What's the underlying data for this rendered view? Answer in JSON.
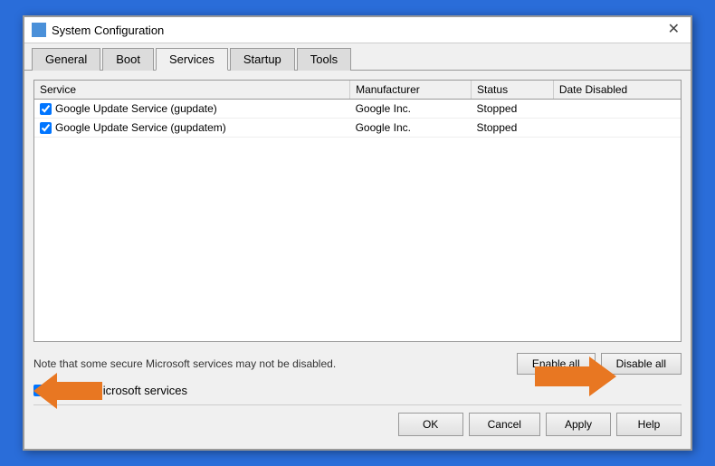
{
  "window": {
    "title": "System Configuration",
    "close_label": "✕"
  },
  "tabs": [
    {
      "id": "general",
      "label": "General"
    },
    {
      "id": "boot",
      "label": "Boot"
    },
    {
      "id": "services",
      "label": "Services"
    },
    {
      "id": "startup",
      "label": "Startup"
    },
    {
      "id": "tools",
      "label": "Tools"
    }
  ],
  "active_tab": "services",
  "table": {
    "columns": [
      "Service",
      "Manufacturer",
      "Status",
      "Date Disabled"
    ],
    "rows": [
      {
        "checked": true,
        "service": "Google Update Service (gupdate)",
        "manufacturer": "Google Inc.",
        "status": "Stopped",
        "date_disabled": ""
      },
      {
        "checked": true,
        "service": "Google Update Service (gupdatem)",
        "manufacturer": "Google Inc.",
        "status": "Stopped",
        "date_disabled": ""
      }
    ]
  },
  "note_text": "Note that some secure Microsoft services may not be disabled.",
  "enable_all_label": "Enable all",
  "disable_all_label": "Disable all",
  "hide_ms_label": "Hide all Microsoft services",
  "buttons": {
    "ok": "OK",
    "cancel": "Cancel",
    "apply": "Apply",
    "help": "Help"
  }
}
